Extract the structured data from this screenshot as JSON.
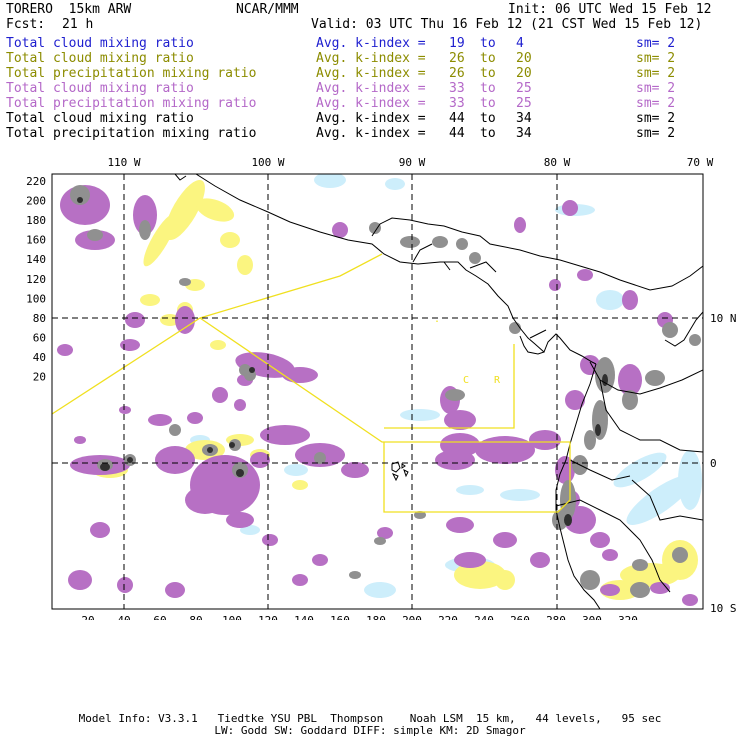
{
  "header": {
    "model": "TORERO  15km ARW",
    "org": "NCAR/MMM",
    "init": "Init: 06 UTC Wed 15 Feb 12",
    "fcst_label": "Fcst:",
    "fcst_hours": "21 h",
    "valid": "Valid: 03 UTC Thu 16 Feb 12 (21 CST Wed 15 Feb 12)"
  },
  "legend": [
    {
      "field": "Total cloud mixing ratio",
      "index": "Avg. k-index =",
      "from": "19",
      "to_word": "to",
      "to": "4",
      "sm": "sm= 2",
      "color": "#1e1ecf"
    },
    {
      "field": "Total cloud mixing ratio",
      "index": "Avg. k-index =",
      "from": "26",
      "to_word": "to",
      "to": "20",
      "sm": "sm= 2",
      "color": "#8c8c00"
    },
    {
      "field": "Total precipitation mixing ratio",
      "index": "Avg. k-index =",
      "from": "26",
      "to_word": "to",
      "to": "20",
      "sm": "sm= 2",
      "color": "#8c8c00"
    },
    {
      "field": "Total cloud mixing ratio",
      "index": "Avg. k-index =",
      "from": "33",
      "to_word": "to",
      "to": "25",
      "sm": "sm= 2",
      "color": "#b468c8"
    },
    {
      "field": "Total precipitation mixing ratio",
      "index": "Avg. k-index =",
      "from": "33",
      "to_word": "to",
      "to": "25",
      "sm": "sm= 2",
      "color": "#b468c8"
    },
    {
      "field": "Total cloud mixing ratio",
      "index": "Avg. k-index =",
      "from": "44",
      "to_word": "to",
      "to": "34",
      "sm": "sm= 2",
      "color": "#000000"
    },
    {
      "field": "Total precipitation mixing ratio",
      "index": "Avg. k-index =",
      "from": "44",
      "to_word": "to",
      "to": "34",
      "sm": "sm= 2",
      "color": "#000000"
    }
  ],
  "map": {
    "lon_labels": [
      "110 W",
      "100 W",
      "90 W",
      "80 W",
      "70 W"
    ],
    "lat_labels": [
      "10 N",
      "0",
      "10 S"
    ],
    "y_ticks": [
      "220",
      "200",
      "180",
      "160",
      "140",
      "120",
      "100",
      "80",
      "60",
      "40",
      "20"
    ],
    "x_ticks": [
      "20",
      "40",
      "60",
      "80",
      "100",
      "120",
      "140",
      "160",
      "180",
      "200",
      "220",
      "240",
      "260",
      "280",
      "300",
      "320"
    ],
    "region_letters": [
      "C",
      "R"
    ],
    "colors": {
      "light_blue": "#cdeefb",
      "yellow": "#fbf580",
      "purple": "#b770c4",
      "gray": "#909090",
      "dark": "#303030",
      "box": "#f0e020"
    }
  },
  "footer": {
    "line1": "Model Info: V3.3.1   Tiedtke YSU PBL  Thompson    Noah LSM  15 km,   44 levels,   95 sec",
    "line2": "LW: Godd SW: Goddard DIFF: simple KM: 2D Smagor"
  }
}
